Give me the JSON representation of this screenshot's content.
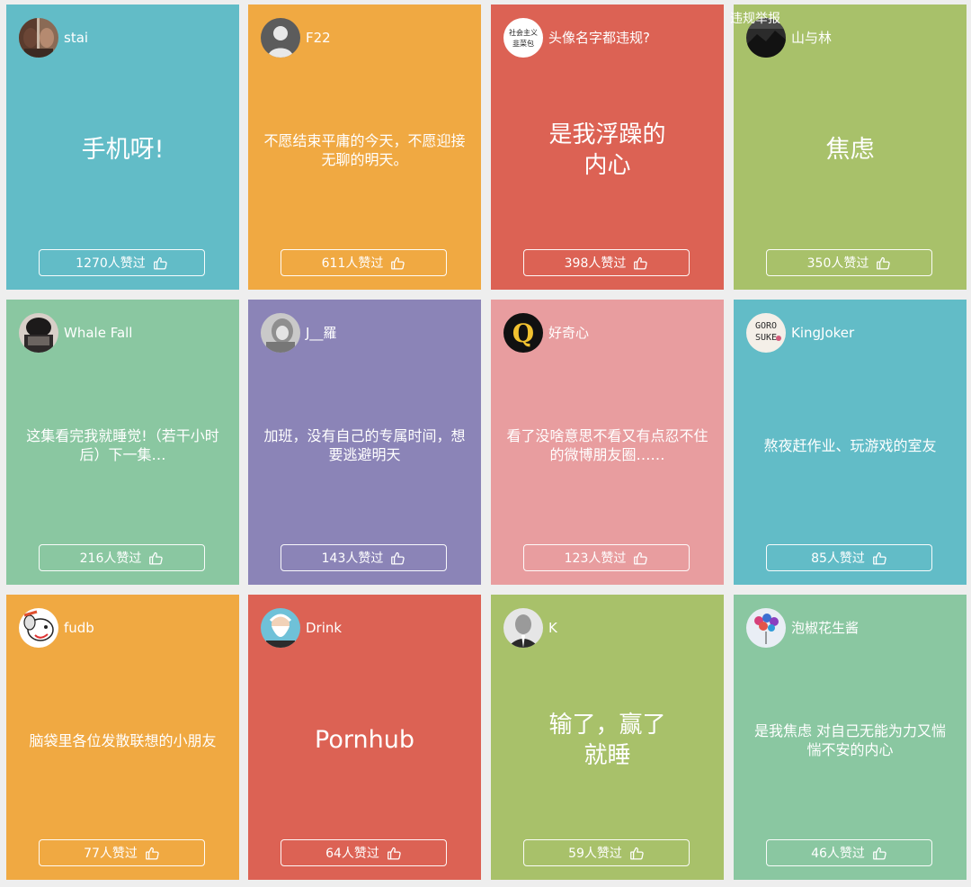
{
  "report_link": "违规举报",
  "like_suffix": "人赞过",
  "colors": {
    "teal": "#62bcc7",
    "orange": "#f0a942",
    "red": "#dc6254",
    "olive": "#a8c16a",
    "green": "#8ac7a1",
    "purple": "#8b84b7",
    "pink": "#e89d9f"
  },
  "cards": [
    {
      "username": "stai",
      "text": "手机呀!",
      "likes": "1270人赞过",
      "avatar_icon": "portrait-two-women-avatar",
      "color": "#62bcc7"
    },
    {
      "username": "F22",
      "text": "不愿结束平庸的今天，不愿迎接无聊的明天。",
      "likes": "611人赞过",
      "avatar_icon": "default-user-silhouette-avatar",
      "color": "#f0a942"
    },
    {
      "username": "头像名字都违规?",
      "text": "是我浮躁的内心",
      "likes": "398人赞过",
      "avatar_icon": "text-badge-avatar",
      "avatar_text": [
        "社会主义",
        "韭菜包"
      ],
      "color": "#dc6254"
    },
    {
      "username": "山与林",
      "text": "焦虑",
      "likes": "350人赞过",
      "avatar_icon": "dark-landscape-avatar",
      "color": "#a8c16a"
    },
    {
      "username": "Whale Fall",
      "text": "这集看完我就睡觉!（若干小时后）下一集…",
      "likes": "216人赞过",
      "avatar_icon": "dark-hair-portrait-avatar",
      "color": "#8ac7a1"
    },
    {
      "username": "J__羅",
      "text": "加班，没有自己的专属时间，想要逃避明天",
      "likes": "143人赞过",
      "avatar_icon": "grey-hooded-figure-avatar",
      "color": "#8b84b7"
    },
    {
      "username": "好奇心",
      "text": "看了没啥意思不看又有点忍不住的微博朋友圈……",
      "likes": "123人赞过",
      "avatar_icon": "letter-q-logo-avatar",
      "avatar_text": [
        "Q"
      ],
      "color": "#e89d9f"
    },
    {
      "username": "KingJoker",
      "text": "熬夜赶作业、玩游戏的室友",
      "likes": "85人赞过",
      "avatar_icon": "goro-suke-sticker-avatar",
      "avatar_text": [
        "GORO",
        "SUKE"
      ],
      "color": "#62bcc7"
    },
    {
      "username": "fudb",
      "text": "脑袋里各位发散联想的小朋友",
      "likes": "77人赞过",
      "avatar_icon": "cartoon-dog-avatar",
      "color": "#f0a942"
    },
    {
      "username": "Drink",
      "text": "Pornhub",
      "likes": "64人赞过",
      "avatar_icon": "bearded-old-man-avatar",
      "color": "#dc6254"
    },
    {
      "username": "K",
      "text": "输了，赢了就睡",
      "likes": "59人赞过",
      "avatar_icon": "man-in-suit-avatar",
      "color": "#a8c16a"
    },
    {
      "username": "泡椒花生酱",
      "text": "是我焦虑 对自己无能为力又惴惴不安的内心",
      "likes": "46人赞过",
      "avatar_icon": "colorful-balloons-avatar",
      "color": "#8ac7a1"
    }
  ]
}
